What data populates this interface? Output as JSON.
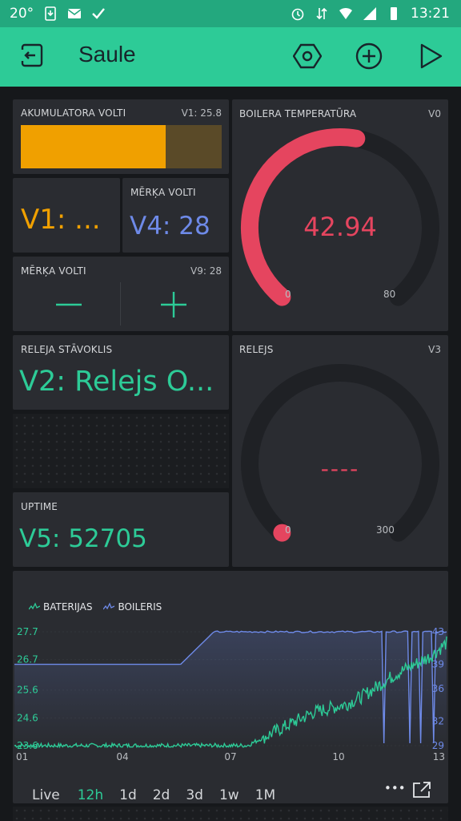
{
  "status_bar": {
    "temperature": "20°",
    "time": "13:21"
  },
  "app_bar": {
    "title": "Saule"
  },
  "widgets": {
    "battery_level": {
      "label": "AKUMULATORA VOLTI",
      "pin": "V1: 25.8",
      "fill_fraction": 0.72,
      "color": "#f0a000",
      "track_color": "#5a4a28"
    },
    "v1_display": {
      "value": "V1: ...",
      "color": "#f0a000"
    },
    "v4_display": {
      "label": "MĒRĶA VOLTI",
      "value": "V4: 28",
      "color": "#6e8ae8"
    },
    "step_control": {
      "label": "MĒRĶA VOLTI",
      "pin": "V9: 28",
      "minus": "—",
      "plus": "+",
      "color": "#2dcb97"
    },
    "relay_state": {
      "label": "RELEJA STĀVOKLIS",
      "value": "V2: Relejs O...",
      "color": "#2dcb97"
    },
    "uptime": {
      "label": "UPTIME",
      "value": "V5: 52705",
      "color": "#2dcb97"
    },
    "boiler_gauge": {
      "label": "BOILERA TEMPERATŪRA",
      "pin": "V0",
      "value": "42.94",
      "min": "0",
      "max": "80",
      "fraction": 0.537,
      "color": "#e5455f"
    },
    "relay_gauge": {
      "label": "RELEJS",
      "pin": "V3",
      "value": "----",
      "min": "0",
      "max": "300",
      "fraction": 0.0,
      "color": "#e5455f"
    }
  },
  "chart": {
    "legend": [
      {
        "name": "BATERIJAS",
        "color": "#2dcb97"
      },
      {
        "name": "BOILERIS",
        "color": "#6e8ae8"
      }
    ],
    "left_ticks": [
      "27.7",
      "26.7",
      "25.6",
      "24.6",
      "23.6"
    ],
    "right_ticks": [
      "43",
      "39",
      "36",
      "32",
      "29"
    ],
    "x_ticks": [
      "01",
      "04",
      "07",
      "10",
      "13"
    ],
    "tabs": [
      "Live",
      "12h",
      "1d",
      "2d",
      "3d",
      "1w",
      "1M"
    ],
    "active_tab": "12h",
    "more": "•••"
  },
  "chart_data": {
    "type": "line",
    "x_ticks": [
      "01",
      "04",
      "07",
      "10",
      "13"
    ],
    "x": [
      0,
      1,
      2,
      3,
      4,
      5,
      6,
      7,
      8,
      9,
      10,
      10.5,
      11,
      11.5,
      12,
      12.5,
      13
    ],
    "series": [
      {
        "name": "BATERIJAS",
        "axis": "left",
        "color": "#2dcb97",
        "values": [
          23.6,
          23.6,
          23.6,
          23.6,
          23.6,
          23.6,
          23.6,
          23.6,
          24.2,
          24.8,
          25.1,
          25.4,
          25.8,
          26.2,
          26.5,
          26.8,
          27.3
        ]
      },
      {
        "name": "BOILERIS",
        "axis": "right",
        "color": "#6e8ae8",
        "values": [
          39,
          39,
          39,
          39,
          39,
          39,
          43,
          43,
          43,
          43,
          43,
          43,
          43,
          43,
          43,
          43,
          43
        ]
      }
    ],
    "ylim_left": [
      23.6,
      27.7
    ],
    "ylim_right": [
      29,
      43
    ]
  }
}
